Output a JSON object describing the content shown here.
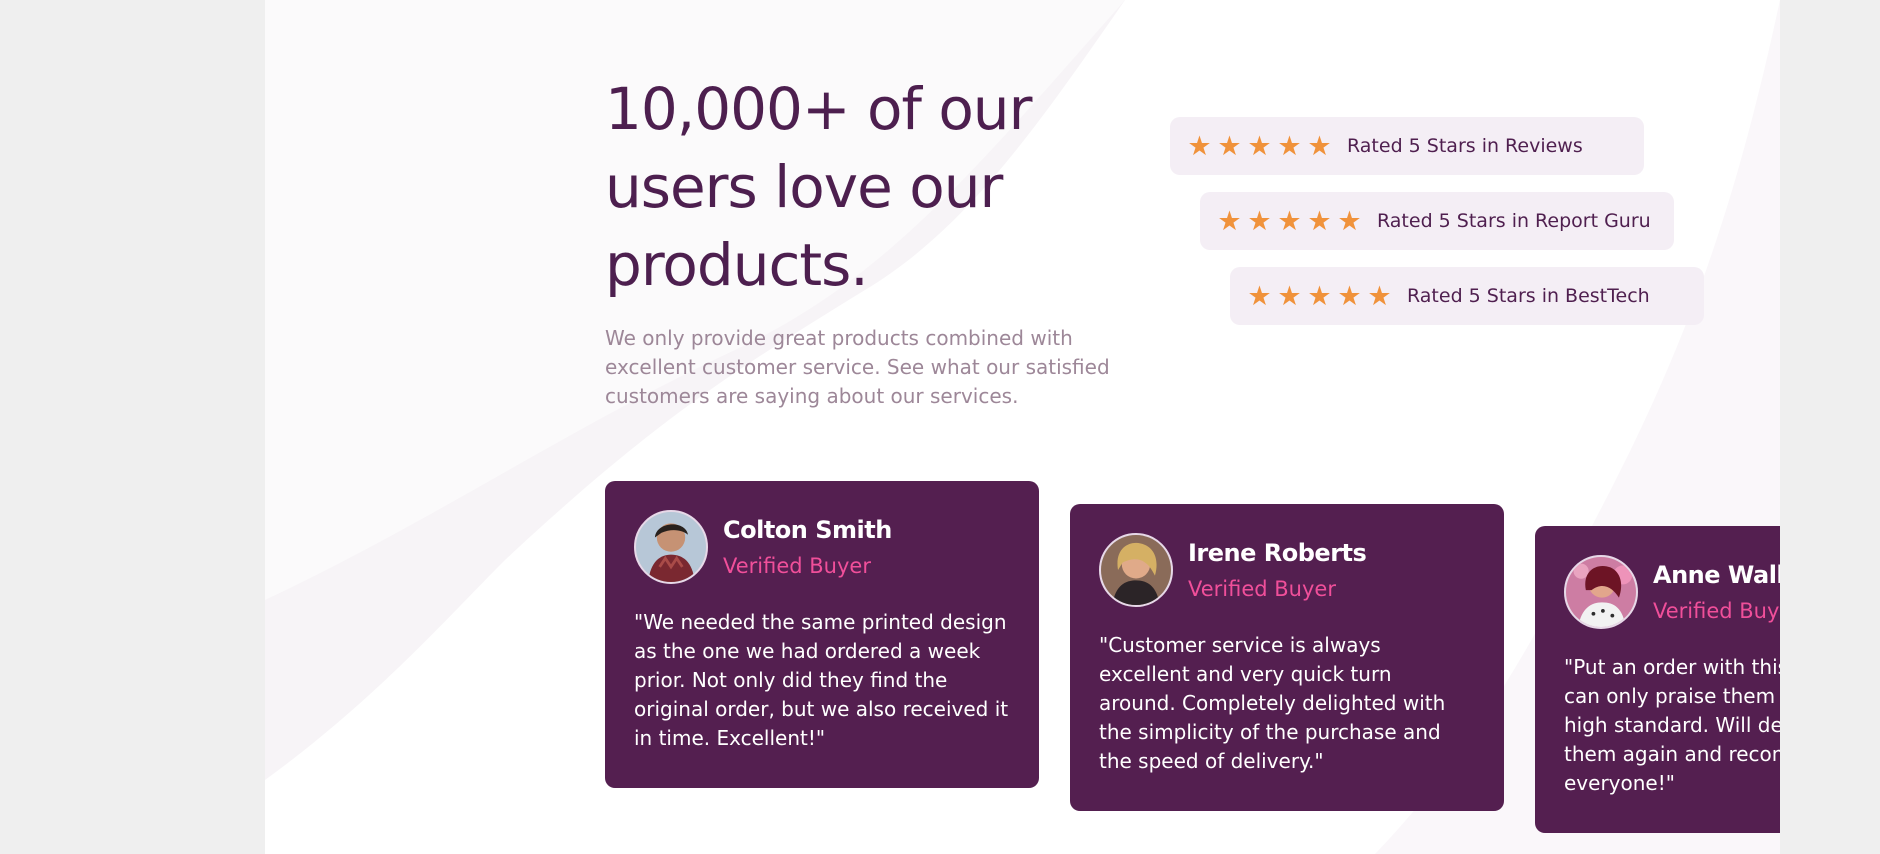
{
  "hero": {
    "headline": "10,000+ of our users love our products.",
    "subtext": "We only provide great products combined with excellent customer service. See what our satisfied customers are saying about our services."
  },
  "ratings": [
    {
      "stars": 5,
      "label": "Rated 5 Stars in Reviews"
    },
    {
      "stars": 5,
      "label": "Rated 5 Stars in Report Guru"
    },
    {
      "stars": 5,
      "label": "Rated 5 Stars in BestTech"
    }
  ],
  "testimonials": [
    {
      "name": "Colton Smith",
      "badge": "Verified Buyer",
      "quote": "\"We needed the same printed design as the one we had ordered a week prior. Not only did they find the original order, but we also received it in time. Excellent!\""
    },
    {
      "name": "Irene Roberts",
      "badge": "Verified Buyer",
      "quote": "\"Customer service is always excellent and very quick turn around. Completely delighted with the simplicity of the purchase and the speed of delivery.\""
    },
    {
      "name": "Anne Wallace",
      "badge": "Verified Buyer",
      "quote": "\"Put an order with this company and can only praise them for the very high standard. Will definitely use them again and recommend them to everyone!\""
    }
  ],
  "colors": {
    "primary": "#541f50",
    "accent": "#f04f9a",
    "star": "#f0923b",
    "page": "#ffffff",
    "rating_bg": "#f4eef5"
  },
  "icons": {
    "star": "star-icon"
  }
}
